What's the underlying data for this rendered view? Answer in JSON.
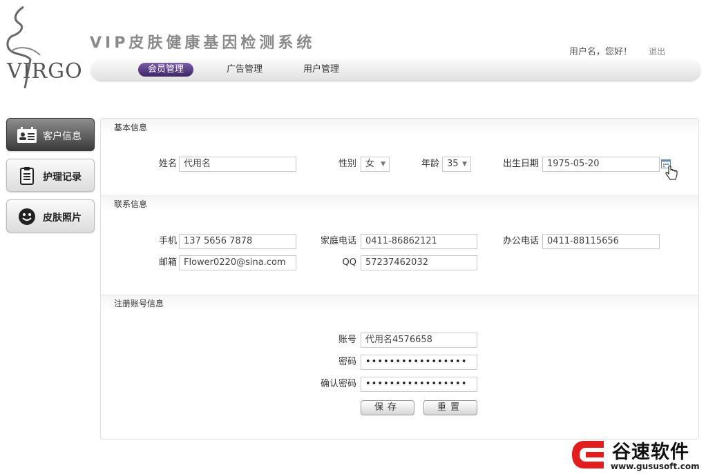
{
  "header": {
    "logo_text": "VIRGO",
    "app_title": "VIP皮肤健康基因检测系统",
    "greeting": "用户名，您好！",
    "logout": "退出"
  },
  "nav": {
    "items": [
      {
        "label": "会员管理",
        "active": true
      },
      {
        "label": "广告管理",
        "active": false
      },
      {
        "label": "用户管理",
        "active": false
      }
    ]
  },
  "sidebar": {
    "items": [
      {
        "label": "客户信息",
        "icon": "id-card-icon",
        "active": true
      },
      {
        "label": "护理记录",
        "icon": "clipboard-icon",
        "active": false
      },
      {
        "label": "皮肤照片",
        "icon": "smiley-icon",
        "active": false
      }
    ]
  },
  "basic": {
    "heading": "基本信息",
    "name_label": "姓名",
    "name_value": "代用名",
    "gender_label": "性别",
    "gender_value": "女",
    "age_label": "年龄",
    "age_value": "35",
    "birth_label": "出生日期",
    "birth_value": "1975-05-20"
  },
  "contact": {
    "heading": "联系信息",
    "mobile_label": "手机",
    "mobile_value": "137 5656 7878",
    "home_label": "家庭电话",
    "home_value": "0411-86862121",
    "office_label": "办公电话",
    "office_value": "0411-88115656",
    "email_label": "邮箱",
    "email_value": "Flower0220@sina.com",
    "qq_label": "QQ",
    "qq_value": "57237462032"
  },
  "account": {
    "heading": "注册账号信息",
    "account_label": "账号",
    "account_value": "代用名4576658",
    "password_label": "密码",
    "password_value": "•••••••••••••••••",
    "confirm_label": "确认密码",
    "confirm_value": "•••••••••••••••••",
    "save_button": "保存",
    "reset_button": "重置"
  },
  "watermark": {
    "brand": "谷速软件",
    "url": "www.gususoft.com"
  },
  "colors": {
    "nav_active": "#4b2f7a",
    "sidebar_active": "#3a3a3a",
    "watermark_red": "#e21d1d"
  }
}
